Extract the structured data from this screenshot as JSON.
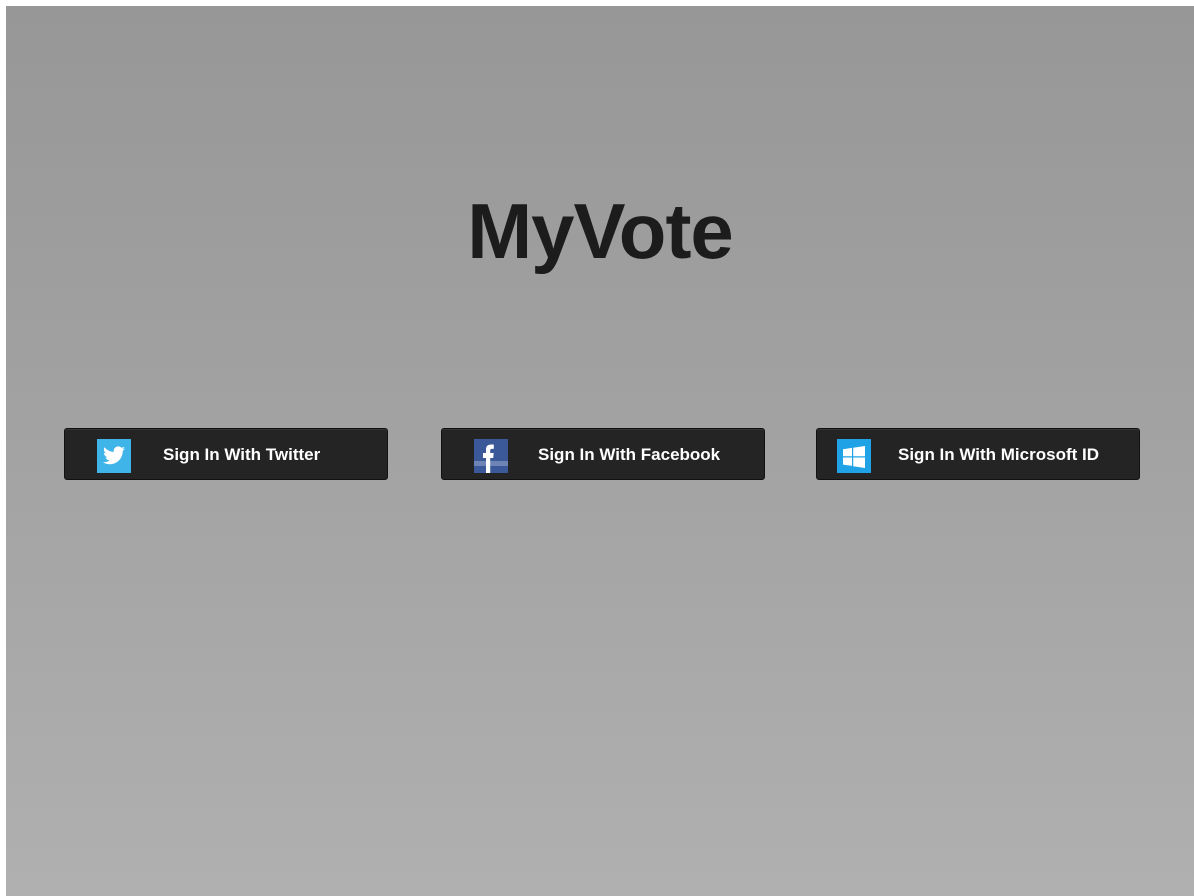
{
  "app": {
    "title": "MyVote"
  },
  "signin": {
    "buttons": [
      {
        "label": "Sign In With Twitter",
        "icon": "twitter-icon",
        "color": "#3fb4e8"
      },
      {
        "label": "Sign In With Facebook",
        "icon": "facebook-icon",
        "color": "#3b5998"
      },
      {
        "label": "Sign In With Microsoft ID",
        "icon": "windows-icon",
        "color": "#1fa3e6"
      }
    ]
  }
}
